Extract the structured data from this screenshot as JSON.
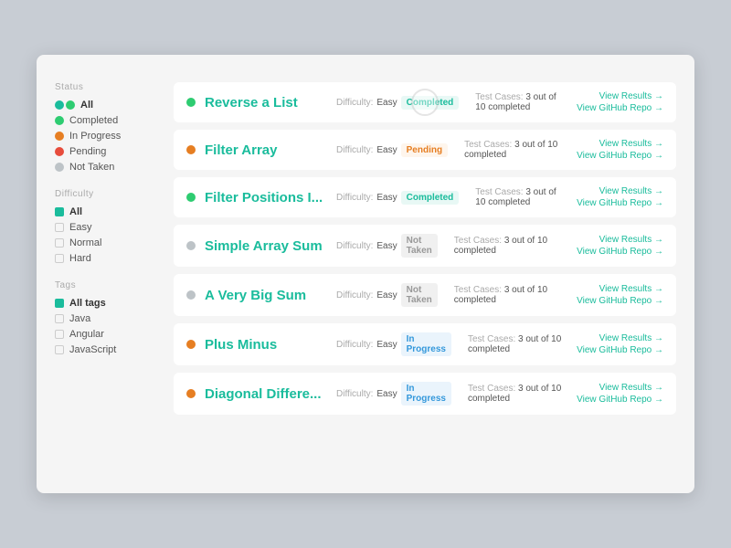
{
  "sidebar": {
    "status_section": {
      "title": "Status",
      "items": [
        {
          "label": "All",
          "active": true,
          "dot_class": "dot-teal dot-green",
          "type": "dot-two"
        },
        {
          "label": "Completed",
          "active": false,
          "dot_class": "dot-green",
          "type": "dot"
        },
        {
          "label": "In Progress",
          "active": false,
          "dot_class": "dot-orange",
          "type": "dot"
        },
        {
          "label": "Pending",
          "active": false,
          "dot_class": "dot-red",
          "type": "dot"
        },
        {
          "label": "Not Taken",
          "active": false,
          "dot_class": "dot-gray",
          "type": "dot"
        }
      ]
    },
    "difficulty_section": {
      "title": "Difficulty",
      "items": [
        {
          "label": "All",
          "active": true,
          "type": "square",
          "sq_class": "sq-teal"
        },
        {
          "label": "Easy",
          "active": false,
          "type": "checkbox"
        },
        {
          "label": "Normal",
          "active": false,
          "type": "checkbox"
        },
        {
          "label": "Hard",
          "active": false,
          "type": "checkbox"
        }
      ]
    },
    "tags_section": {
      "title": "Tags",
      "items": [
        {
          "label": "All tags",
          "active": true,
          "type": "square",
          "sq_class": "sq-teal"
        },
        {
          "label": "Java",
          "active": false,
          "type": "checkbox"
        },
        {
          "label": "Angular",
          "active": false,
          "type": "checkbox"
        },
        {
          "label": "JavaScript",
          "active": false,
          "type": "checkbox"
        }
      ]
    }
  },
  "problems": [
    {
      "id": 1,
      "title": "Reverse a List",
      "difficulty": "Easy",
      "status": "Completed",
      "status_class": "badge-completed",
      "dot_class": "dot-green",
      "test_cases": "3 out of 10 completed",
      "has_circle": true
    },
    {
      "id": 2,
      "title": "Filter Array",
      "difficulty": "Easy",
      "status": "Pending",
      "status_class": "badge-pending",
      "dot_class": "dot-orange",
      "test_cases": "3 out of 10 completed",
      "has_circle": false
    },
    {
      "id": 3,
      "title": "Filter Positions I...",
      "difficulty": "Easy",
      "status": "Completed",
      "status_class": "badge-completed",
      "dot_class": "dot-green",
      "test_cases": "3 out of 10 completed",
      "has_circle": false
    },
    {
      "id": 4,
      "title": "Simple Array Sum",
      "difficulty": "Easy",
      "status": "Not Taken",
      "status_class": "badge-not-taken",
      "dot_class": "dot-gray",
      "test_cases": "3 out of 10 completed",
      "has_circle": false
    },
    {
      "id": 5,
      "title": "A Very Big Sum",
      "difficulty": "Easy",
      "status": "Not Taken",
      "status_class": "badge-not-taken",
      "dot_class": "dot-gray",
      "test_cases": "3 out of 10 completed",
      "has_circle": false
    },
    {
      "id": 6,
      "title": "Plus Minus",
      "difficulty": "Easy",
      "status": "In Progress",
      "status_class": "badge-in-progress",
      "dot_class": "dot-orange",
      "test_cases": "3 out of 10 completed",
      "has_circle": false
    },
    {
      "id": 7,
      "title": "Diagonal Differe...",
      "difficulty": "Easy",
      "status": "In Progress",
      "status_class": "badge-in-progress",
      "dot_class": "dot-orange",
      "test_cases": "3 out of 10 completed",
      "has_circle": false
    }
  ],
  "labels": {
    "difficulty_prefix": "Difficulty:",
    "test_cases_prefix": "Test Cases:",
    "view_results": "View Results →",
    "view_github": "View GitHub Repo →"
  }
}
